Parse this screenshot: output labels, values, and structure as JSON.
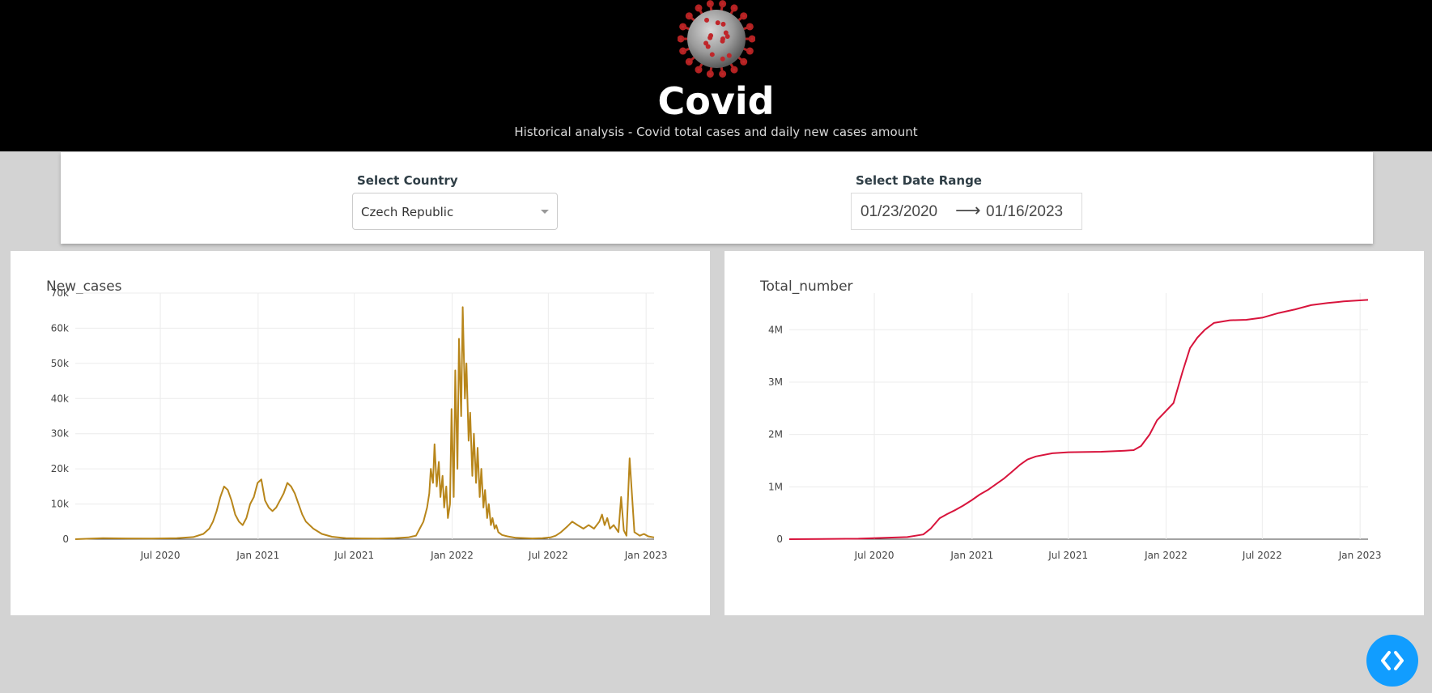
{
  "header": {
    "title": "Covid",
    "subtitle": "Historical analysis - Covid total cases and daily new cases amount",
    "logo_icon": "coronavirus-icon"
  },
  "controls": {
    "country_label": "Select Country",
    "country_value": "Czech Republic",
    "date_label": "Select Date Range",
    "start_date": "01/23/2020",
    "end_date": "01/16/2023"
  },
  "colors": {
    "header_bg": "#000000",
    "page_bg": "#d3d3d3",
    "new_cases_line": "#b8861b",
    "total_line": "#d8143c",
    "code_button": "#119dff"
  },
  "code_button_icon": "code-chevrons-icon",
  "chart_data": [
    {
      "type": "line",
      "title": "New_cases",
      "x_ticks": [
        "Jul 2020",
        "Jan 2021",
        "Jul 2021",
        "Jan 2022",
        "Jul 2022",
        "Jan 2023"
      ],
      "y_ticks": [
        "0",
        "10k",
        "20k",
        "30k",
        "40k",
        "50k",
        "60k",
        "70k"
      ],
      "xlim": [
        "2020-01-23",
        "2023-01-16"
      ],
      "ylim": [
        0,
        70000
      ],
      "grid": true,
      "series": [
        {
          "x": [
            "2020-01-23",
            "2020-03-15",
            "2020-05-01",
            "2020-06-15",
            "2020-08-01",
            "2020-09-01",
            "2020-09-20",
            "2020-10-01",
            "2020-10-08",
            "2020-10-15",
            "2020-10-22",
            "2020-10-29",
            "2020-11-05",
            "2020-11-12",
            "2020-11-19",
            "2020-11-26",
            "2020-12-03",
            "2020-12-10",
            "2020-12-17",
            "2020-12-24",
            "2020-12-31",
            "2021-01-07",
            "2021-01-14",
            "2021-01-21",
            "2021-01-28",
            "2021-02-04",
            "2021-02-11",
            "2021-02-18",
            "2021-02-25",
            "2021-03-04",
            "2021-03-11",
            "2021-03-18",
            "2021-03-25",
            "2021-04-01",
            "2021-04-15",
            "2021-05-01",
            "2021-05-20",
            "2021-06-15",
            "2021-07-15",
            "2021-08-15",
            "2021-09-15",
            "2021-10-10",
            "2021-10-25",
            "2021-11-01",
            "2021-11-08",
            "2021-11-15",
            "2021-11-19",
            "2021-11-22",
            "2021-11-26",
            "2021-11-29",
            "2021-12-03",
            "2021-12-07",
            "2021-12-10",
            "2021-12-14",
            "2021-12-17",
            "2021-12-21",
            "2021-12-24",
            "2021-12-28",
            "2021-12-31",
            "2022-01-04",
            "2022-01-07",
            "2022-01-11",
            "2022-01-14",
            "2022-01-18",
            "2022-01-21",
            "2022-01-25",
            "2022-01-28",
            "2022-02-01",
            "2022-02-04",
            "2022-02-08",
            "2022-02-11",
            "2022-02-15",
            "2022-02-18",
            "2022-02-22",
            "2022-02-25",
            "2022-03-01",
            "2022-03-04",
            "2022-03-08",
            "2022-03-11",
            "2022-03-15",
            "2022-03-18",
            "2022-03-22",
            "2022-03-25",
            "2022-03-29",
            "2022-04-05",
            "2022-04-15",
            "2022-05-01",
            "2022-06-01",
            "2022-06-20",
            "2022-07-05",
            "2022-07-15",
            "2022-07-25",
            "2022-08-05",
            "2022-08-15",
            "2022-08-25",
            "2022-09-05",
            "2022-09-15",
            "2022-09-25",
            "2022-10-05",
            "2022-10-10",
            "2022-10-15",
            "2022-10-20",
            "2022-10-25",
            "2022-11-01",
            "2022-11-10",
            "2022-11-15",
            "2022-11-20",
            "2022-11-25",
            "2022-12-01",
            "2022-12-10",
            "2022-12-20",
            "2022-12-28",
            "2023-01-05",
            "2023-01-16"
          ],
          "values": [
            0,
            300,
            200,
            150,
            300,
            600,
            1500,
            3000,
            5000,
            8000,
            12000,
            15000,
            14000,
            11000,
            7000,
            5000,
            4000,
            6000,
            10000,
            12000,
            16000,
            17000,
            11000,
            9000,
            8000,
            9000,
            11000,
            13000,
            16000,
            15000,
            13000,
            10000,
            7000,
            5000,
            3000,
            1500,
            700,
            300,
            200,
            150,
            300,
            500,
            1000,
            3000,
            5000,
            9000,
            13000,
            20000,
            16000,
            27000,
            15000,
            22000,
            12000,
            18000,
            9000,
            15000,
            6000,
            10000,
            37000,
            12000,
            48000,
            20000,
            57000,
            35000,
            66000,
            40000,
            50000,
            28000,
            36000,
            18000,
            30000,
            16000,
            26000,
            12000,
            20000,
            9000,
            14000,
            6000,
            10000,
            4000,
            6000,
            3000,
            4000,
            2000,
            1200,
            800,
            400,
            200,
            300,
            500,
            1000,
            2000,
            3500,
            5000,
            4000,
            3000,
            4000,
            3000,
            5000,
            7000,
            4000,
            6000,
            3000,
            4000,
            2000,
            12000,
            2500,
            1000,
            23000,
            2000,
            1000,
            1500,
            800,
            500
          ],
          "name": ""
        }
      ]
    },
    {
      "type": "line",
      "title": "Total_number",
      "x_ticks": [
        "Jul 2020",
        "Jan 2021",
        "Jul 2021",
        "Jan 2022",
        "Jul 2022",
        "Jan 2023"
      ],
      "y_ticks": [
        "0",
        "1M",
        "2M",
        "3M",
        "4M"
      ],
      "xlim": [
        "2020-01-23",
        "2023-01-16"
      ],
      "ylim": [
        0,
        4700000
      ],
      "grid": true,
      "series": [
        {
          "x": [
            "2020-01-23",
            "2020-06-01",
            "2020-09-01",
            "2020-10-01",
            "2020-10-15",
            "2020-11-01",
            "2020-11-15",
            "2020-12-01",
            "2020-12-15",
            "2021-01-01",
            "2021-01-15",
            "2021-02-01",
            "2021-02-15",
            "2021-03-01",
            "2021-03-15",
            "2021-04-01",
            "2021-04-15",
            "2021-05-01",
            "2021-06-01",
            "2021-07-01",
            "2021-09-01",
            "2021-10-15",
            "2021-11-01",
            "2021-11-15",
            "2021-12-01",
            "2021-12-15",
            "2022-01-01",
            "2022-01-15",
            "2022-02-01",
            "2022-02-15",
            "2022-03-01",
            "2022-03-15",
            "2022-04-01",
            "2022-05-01",
            "2022-06-01",
            "2022-07-01",
            "2022-08-01",
            "2022-09-01",
            "2022-10-01",
            "2022-11-01",
            "2022-12-01",
            "2023-01-16"
          ],
          "values": [
            0,
            10000,
            40000,
            90000,
            200000,
            400000,
            480000,
            560000,
            640000,
            750000,
            850000,
            950000,
            1050000,
            1150000,
            1270000,
            1420000,
            1520000,
            1580000,
            1640000,
            1660000,
            1670000,
            1690000,
            1700000,
            1780000,
            2000000,
            2270000,
            2450000,
            2600000,
            3200000,
            3650000,
            3850000,
            4000000,
            4130000,
            4180000,
            4190000,
            4230000,
            4320000,
            4390000,
            4470000,
            4510000,
            4540000,
            4570000
          ],
          "name": ""
        }
      ]
    }
  ]
}
